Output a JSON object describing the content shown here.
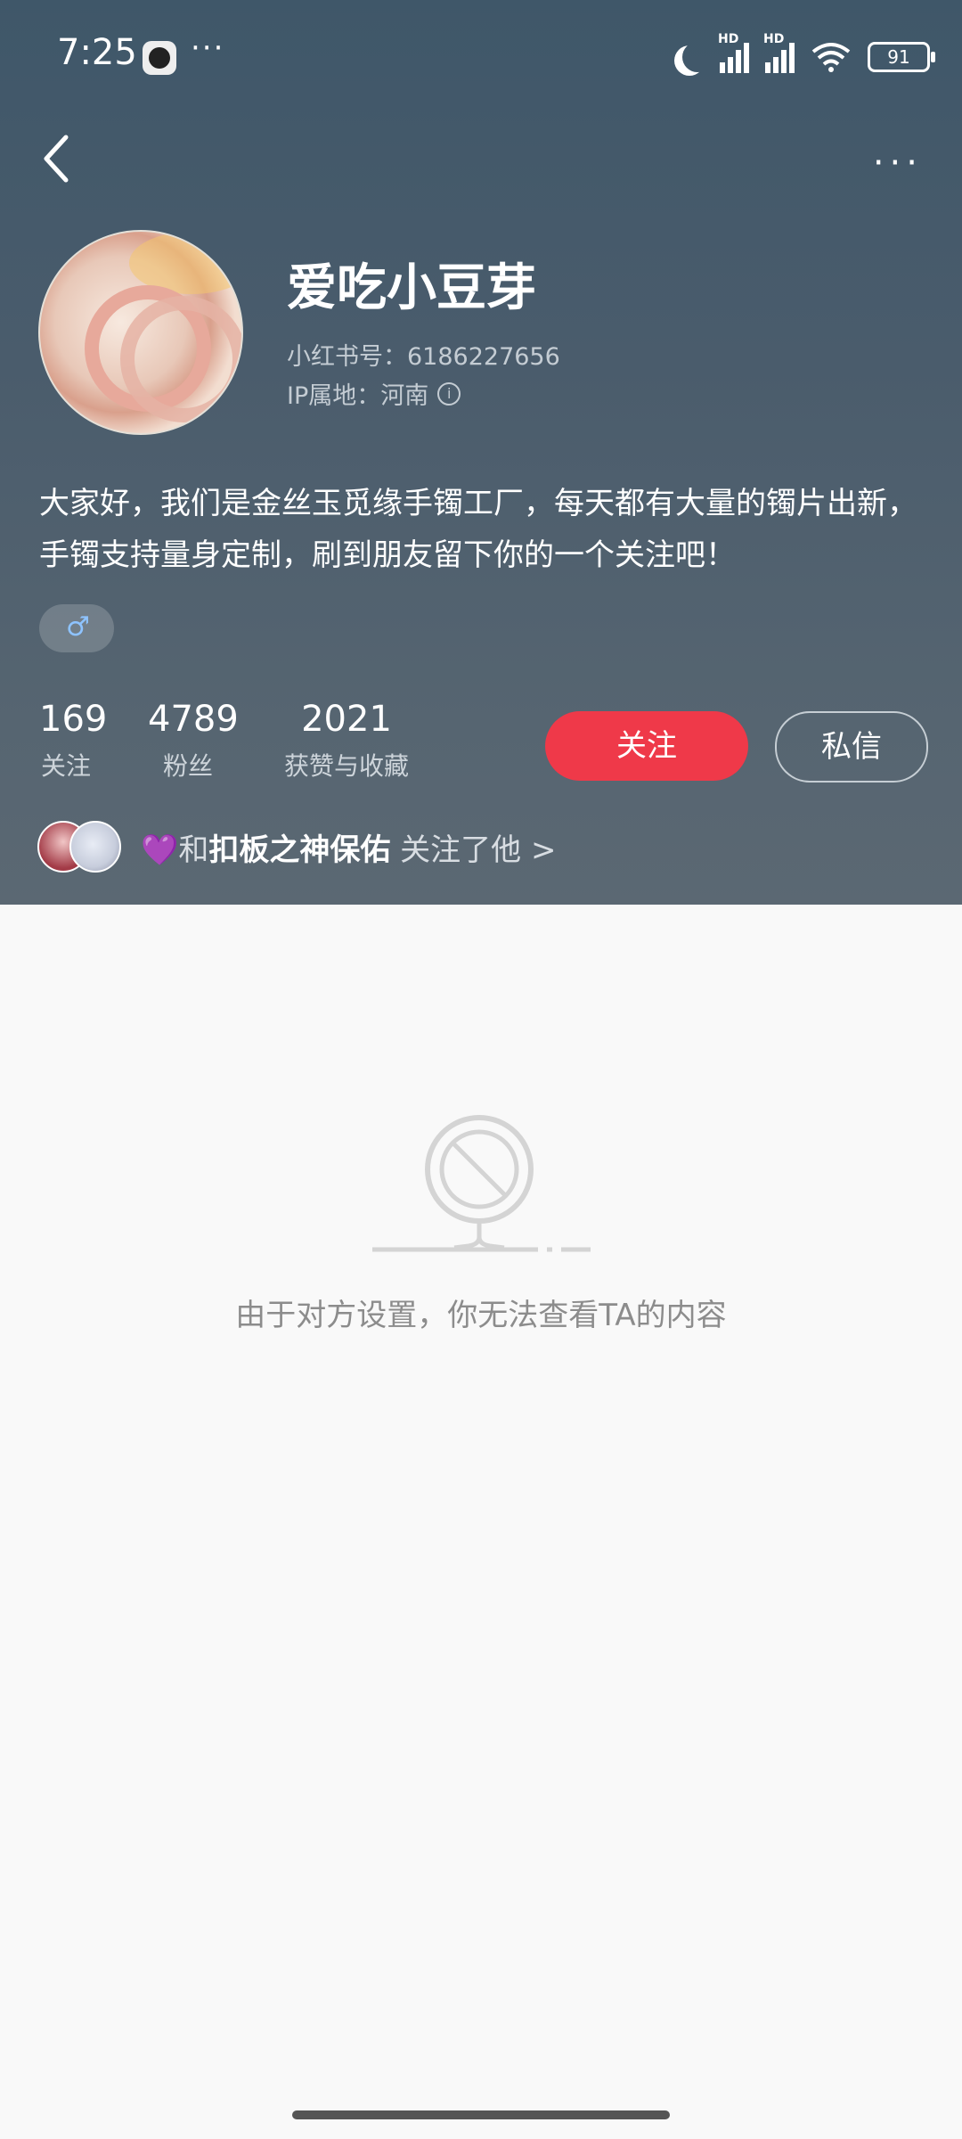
{
  "status_bar": {
    "time": "7:25",
    "more": "···",
    "hd1": "HD",
    "hd2": "HD",
    "battery": "91"
  },
  "nav": {
    "more": "···"
  },
  "profile": {
    "name": "爱吃小豆芽",
    "user_id": "小红书号：6186227656",
    "ip": "IP属地：河南",
    "bio": "大家好，我们是金丝玉觅缘手镯工厂，每天都有大量的镯片出新，手镯支持量身定制，刷到朋友留下你的一个关注吧！",
    "gender": "♂"
  },
  "stats": [
    {
      "value": "169",
      "label": "关注"
    },
    {
      "value": "4789",
      "label": "粉丝"
    },
    {
      "value": "2021",
      "label": "获赞与收藏"
    }
  ],
  "actions": {
    "follow": "关注",
    "message": "私信"
  },
  "mutual": {
    "heart": "💜",
    "prefix": "和",
    "user": "扣板之神保佑",
    "suffix": "关注了他",
    "chevron": ">"
  },
  "content": {
    "empty_message": "由于对方设置，你无法查看TA的内容"
  },
  "colors": {
    "header_bg": "#4a5c6c",
    "follow_red": "#ef3949",
    "page_bg": "#f9f9f9"
  }
}
